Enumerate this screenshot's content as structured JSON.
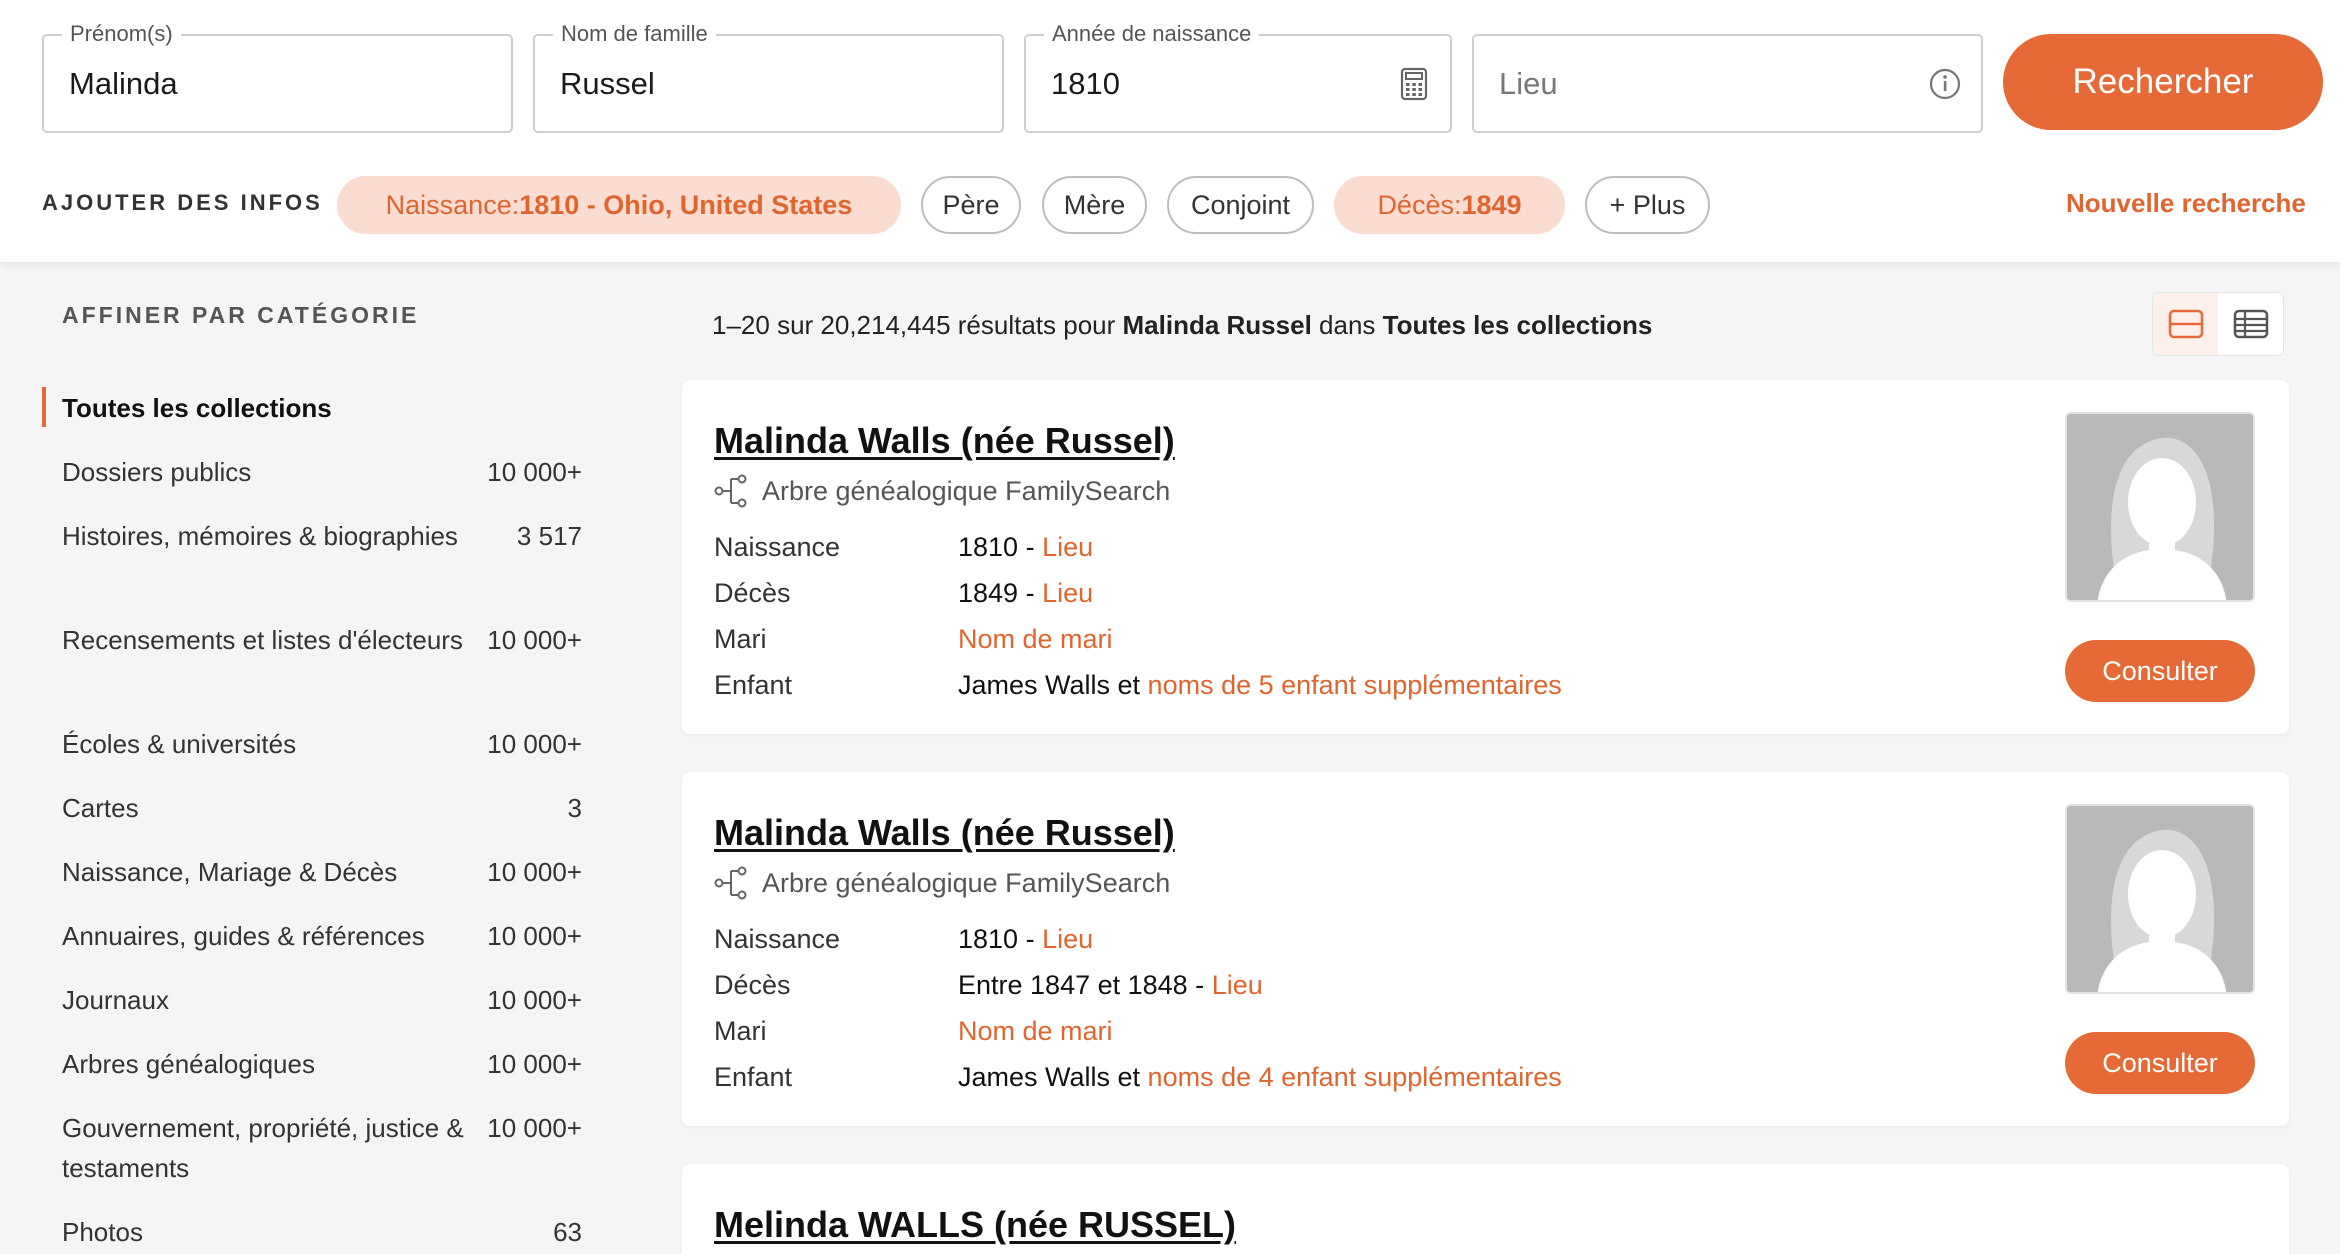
{
  "search": {
    "first_name": {
      "label": "Prénom(s)",
      "value": "Malinda"
    },
    "last_name": {
      "label": "Nom de famille",
      "value": "Russel"
    },
    "birth_year": {
      "label": "Année de naissance",
      "value": "1810"
    },
    "place": {
      "placeholder": "Lieu"
    },
    "search_button": "Rechercher"
  },
  "add_info": {
    "label": "AJOUTER DES INFOS",
    "chips": {
      "birth": {
        "prefix": "Naissance: ",
        "value": "1810 - Ohio, United States"
      },
      "father": "Père",
      "mother": "Mère",
      "spouse": "Conjoint",
      "death": {
        "prefix": "Décès: ",
        "value": "1849"
      },
      "more": "+ Plus"
    },
    "new_search": "Nouvelle recherche"
  },
  "sidebar": {
    "title": "AFFINER PAR CATÉGORIE",
    "active": "Toutes les collections",
    "categories": [
      {
        "name": "Dossiers publics",
        "count": "10 000+"
      },
      {
        "name": "Histoires, mémoires & biographies",
        "count": "3 517"
      },
      {
        "name": "Recensements et listes d'électeurs",
        "count": "10 000+"
      },
      {
        "name": "Écoles & universités",
        "count": "10 000+"
      },
      {
        "name": "Cartes",
        "count": "3"
      },
      {
        "name": "Naissance, Mariage & Décès",
        "count": "10 000+"
      },
      {
        "name": "Annuaires, guides & références",
        "count": "10 000+"
      },
      {
        "name": "Journaux",
        "count": "10 000+"
      },
      {
        "name": "Arbres généalogiques",
        "count": "10 000+"
      },
      {
        "name": "Gouvernement, propriété, justice & testaments",
        "count": "10 000+"
      },
      {
        "name": "Photos",
        "count": "63"
      }
    ]
  },
  "results": {
    "summary_prefix": "1–20 sur 20,214,445 résultats pour ",
    "summary_name": "Malinda Russel",
    "summary_mid": " dans ",
    "summary_collection": "Toutes les collections",
    "items": [
      {
        "name": "Malinda Walls (née Russel)",
        "source": "Arbre généalogique FamilySearch",
        "birth_label": "Naissance",
        "birth_value": "1810 - ",
        "birth_link": "Lieu",
        "death_label": "Décès",
        "death_value": "1849 - ",
        "death_link": "Lieu",
        "spouse_label": "Mari",
        "spouse_link": "Nom de mari",
        "child_label": "Enfant",
        "child_value": "James Walls et ",
        "child_link": "noms de 5 enfant supplémentaires",
        "button": "Consulter"
      },
      {
        "name": "Malinda Walls (née Russel)",
        "source": "Arbre généalogique FamilySearch",
        "birth_label": "Naissance",
        "birth_value": "1810 - ",
        "birth_link": "Lieu",
        "death_label": "Décès",
        "death_value": "Entre 1847 et 1848 - ",
        "death_link": "Lieu",
        "spouse_label": "Mari",
        "spouse_link": "Nom de mari",
        "child_label": "Enfant",
        "child_value": "James Walls et ",
        "child_link": "noms de 4 enfant supplémentaires",
        "button": "Consulter"
      },
      {
        "name": "Melinda WALLS (née RUSSEL)"
      }
    ]
  },
  "colors": {
    "accent": "#e66a37",
    "chip_active_bg": "#fbdcd0",
    "page_bg": "#f5f5f5"
  }
}
